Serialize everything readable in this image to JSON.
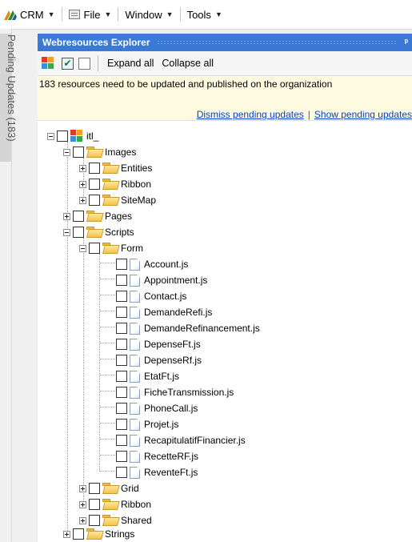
{
  "menubar": {
    "items": [
      {
        "label": "CRM",
        "icon": "crm-logo-icon"
      },
      {
        "label": "File",
        "icon": "file-icon"
      },
      {
        "label": "Window"
      },
      {
        "label": "Tools"
      }
    ]
  },
  "sidebar": {
    "label": "Pending Updates (183)"
  },
  "panel": {
    "title": "Webresources Explorer",
    "toolbar": {
      "expand_all": "Expand all",
      "collapse_all": "Collapse all"
    },
    "notice": {
      "message": "183 resources need to be updated and published on the organization",
      "dismiss_link": "Dismiss pending updates",
      "separator": "|",
      "show_link": "Show pending updates"
    }
  },
  "tree": {
    "root": "itl_",
    "images": {
      "label": "Images",
      "children": [
        "Entities",
        "Ribbon",
        "SiteMap"
      ]
    },
    "pages": "Pages",
    "scripts": {
      "label": "Scripts",
      "form": {
        "label": "Form",
        "files": [
          "Account.js",
          "Appointment.js",
          "Contact.js",
          "DemandeRefi.js",
          "DemandeRefinancement.js",
          "DepenseFt.js",
          "DepenseRf.js",
          "EtatFt.js",
          "FicheTransmission.js",
          "PhoneCall.js",
          "Projet.js",
          "RecapitulatifFinancier.js",
          "RecetteRF.js",
          "ReventeFt.js"
        ]
      },
      "others": [
        "Grid",
        "Ribbon",
        "Shared"
      ]
    },
    "strings": "Strings"
  },
  "colors": {
    "title_bar": "#3b79d6",
    "notice_bg": "#fffbe0",
    "link": "#0a41c4",
    "folder": "#f4c44c"
  }
}
